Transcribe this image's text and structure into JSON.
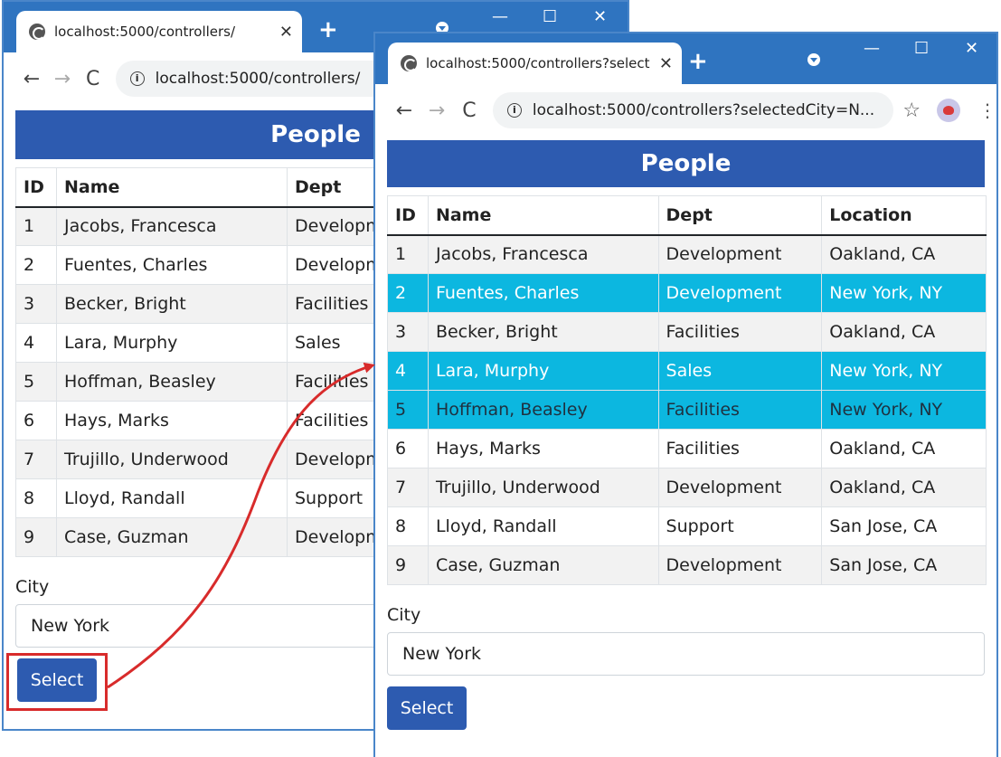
{
  "left_window": {
    "tab_title": "localhost:5000/controllers/",
    "address": "localhost:5000/controllers/",
    "heading": "People",
    "columns": [
      "ID",
      "Name",
      "Dept"
    ],
    "rows": [
      [
        "1",
        "Jacobs, Francesca",
        "Developm"
      ],
      [
        "2",
        "Fuentes, Charles",
        "Developm"
      ],
      [
        "3",
        "Becker, Bright",
        "Facilities"
      ],
      [
        "4",
        "Lara, Murphy",
        "Sales"
      ],
      [
        "5",
        "Hoffman, Beasley",
        "Facilities"
      ],
      [
        "6",
        "Hays, Marks",
        "Facilities"
      ],
      [
        "7",
        "Trujillo, Underwood",
        "Developm"
      ],
      [
        "8",
        "Lloyd, Randall",
        "Support"
      ],
      [
        "9",
        "Case, Guzman",
        "Developm"
      ]
    ],
    "city_label": "City",
    "city_value": "New York",
    "select_label": "Select"
  },
  "right_window": {
    "tab_title": "localhost:5000/controllers?select",
    "address": "localhost:5000/controllers?selectedCity=N...",
    "heading": "People",
    "columns": [
      "ID",
      "Name",
      "Dept",
      "Location"
    ],
    "rows": [
      [
        "1",
        "Jacobs, Francesca",
        "Development",
        "Oakland, CA"
      ],
      [
        "2",
        "Fuentes, Charles",
        "Development",
        "New York, NY"
      ],
      [
        "3",
        "Becker, Bright",
        "Facilities",
        "Oakland, CA"
      ],
      [
        "4",
        "Lara, Murphy",
        "Sales",
        "New York, NY"
      ],
      [
        "5",
        "Hoffman, Beasley",
        "Facilities",
        "New York, NY"
      ],
      [
        "6",
        "Hays, Marks",
        "Facilities",
        "Oakland, CA"
      ],
      [
        "7",
        "Trujillo, Underwood",
        "Development",
        "Oakland, CA"
      ],
      [
        "8",
        "Lloyd, Randall",
        "Support",
        "San Jose, CA"
      ],
      [
        "9",
        "Case, Guzman",
        "Development",
        "San Jose, CA"
      ]
    ],
    "highlighted_rows": [
      2,
      4,
      5
    ],
    "city_label": "City",
    "city_value": "New York",
    "select_label": "Select"
  },
  "colors": {
    "titlebar": "#2f74c0",
    "banner": "#2d5bb0",
    "highlight": "#0cb7e0",
    "callout": "#d82b2b"
  }
}
